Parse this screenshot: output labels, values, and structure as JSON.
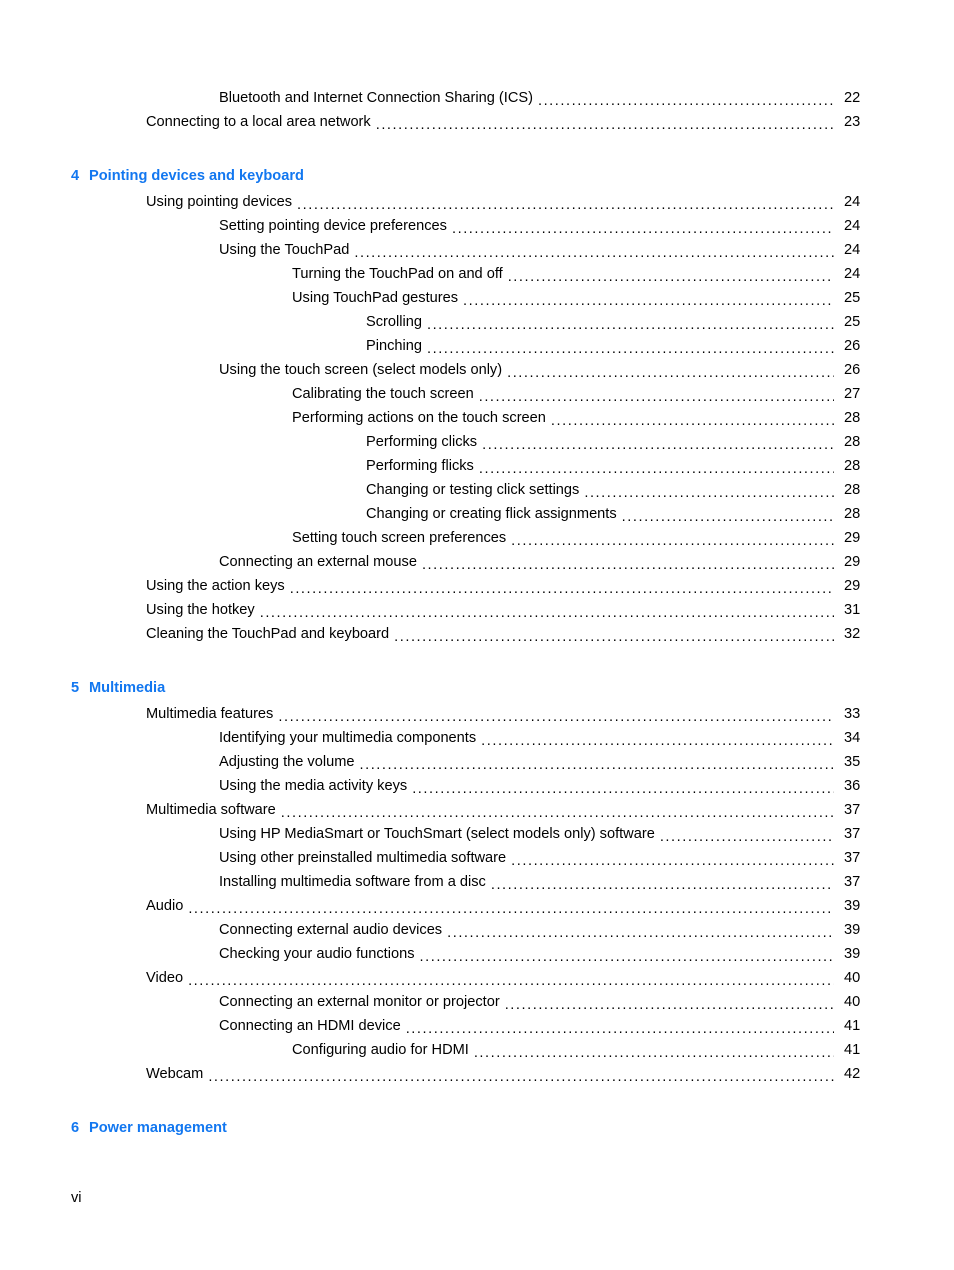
{
  "document": {
    "folio": "vi"
  },
  "toc": {
    "blocks": [
      {
        "type": "entries",
        "entries": [
          {
            "level": 2,
            "title": "Bluetooth and Internet Connection Sharing (ICS)",
            "page": "22"
          },
          {
            "level": 1,
            "title": "Connecting to a local area network",
            "page": "23"
          }
        ]
      },
      {
        "type": "chapter",
        "number": "4",
        "title": "Pointing devices and keyboard"
      },
      {
        "type": "entries",
        "entries": [
          {
            "level": 1,
            "title": "Using pointing devices",
            "page": "24"
          },
          {
            "level": 2,
            "title": "Setting pointing device preferences",
            "page": "24"
          },
          {
            "level": 2,
            "title": "Using the TouchPad",
            "page": "24"
          },
          {
            "level": 3,
            "title": "Turning the TouchPad on and off",
            "page": "24"
          },
          {
            "level": 3,
            "title": "Using TouchPad gestures",
            "page": "25"
          },
          {
            "level": 4,
            "title": "Scrolling",
            "page": "25"
          },
          {
            "level": 4,
            "title": "Pinching",
            "page": "26"
          },
          {
            "level": 2,
            "title": "Using the touch screen (select models only)",
            "page": "26"
          },
          {
            "level": 3,
            "title": "Calibrating the touch screen",
            "page": "27"
          },
          {
            "level": 3,
            "title": "Performing actions on the touch screen",
            "page": "28"
          },
          {
            "level": 4,
            "title": "Performing clicks",
            "page": "28"
          },
          {
            "level": 4,
            "title": "Performing flicks",
            "page": "28"
          },
          {
            "level": 4,
            "title": "Changing or testing click settings",
            "page": "28"
          },
          {
            "level": 4,
            "title": "Changing or creating flick assignments",
            "page": "28"
          },
          {
            "level": 3,
            "title": "Setting touch screen preferences",
            "page": "29"
          },
          {
            "level": 2,
            "title": "Connecting an external mouse",
            "page": "29"
          },
          {
            "level": 1,
            "title": "Using the action keys",
            "page": "29"
          },
          {
            "level": 1,
            "title": "Using the hotkey",
            "page": "31"
          },
          {
            "level": 1,
            "title": "Cleaning the TouchPad and keyboard",
            "page": "32"
          }
        ]
      },
      {
        "type": "chapter",
        "number": "5",
        "title": "Multimedia"
      },
      {
        "type": "entries",
        "entries": [
          {
            "level": 1,
            "title": "Multimedia features",
            "page": "33"
          },
          {
            "level": 2,
            "title": "Identifying your multimedia components",
            "page": "34"
          },
          {
            "level": 2,
            "title": "Adjusting the volume",
            "page": "35"
          },
          {
            "level": 2,
            "title": "Using the media activity keys",
            "page": "36"
          },
          {
            "level": 1,
            "title": "Multimedia software",
            "page": "37"
          },
          {
            "level": 2,
            "title": "Using HP MediaSmart or TouchSmart (select models only) software",
            "page": "37"
          },
          {
            "level": 2,
            "title": "Using other preinstalled multimedia software",
            "page": "37"
          },
          {
            "level": 2,
            "title": "Installing multimedia software from a disc",
            "page": "37"
          },
          {
            "level": 1,
            "title": "Audio",
            "page": "39"
          },
          {
            "level": 2,
            "title": "Connecting external audio devices",
            "page": "39"
          },
          {
            "level": 2,
            "title": "Checking your audio functions",
            "page": "39"
          },
          {
            "level": 1,
            "title": "Video",
            "page": "40"
          },
          {
            "level": 2,
            "title": "Connecting an external monitor or projector",
            "page": "40"
          },
          {
            "level": 2,
            "title": "Connecting an HDMI device",
            "page": "41"
          },
          {
            "level": 3,
            "title": "Configuring audio for HDMI",
            "page": "41"
          },
          {
            "level": 1,
            "title": "Webcam",
            "page": "42"
          }
        ]
      },
      {
        "type": "chapter",
        "number": "6",
        "title": "Power management"
      }
    ]
  },
  "colors": {
    "chapter_heading": "#1277f0",
    "body_text": "#000000",
    "page_background": "#ffffff"
  }
}
